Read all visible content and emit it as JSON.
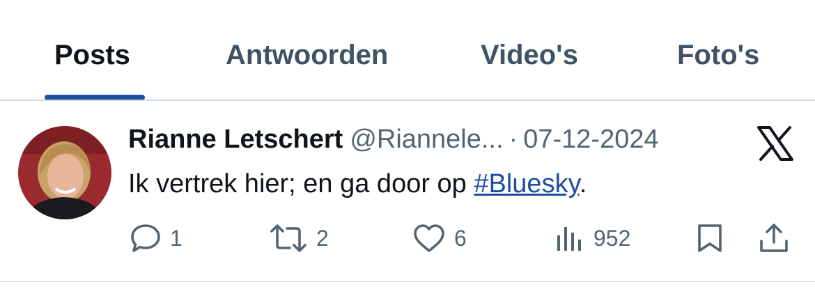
{
  "tabs": [
    {
      "label": "Posts",
      "active": true
    },
    {
      "label": "Antwoorden",
      "active": false
    },
    {
      "label": "Video's",
      "active": false
    },
    {
      "label": "Foto's",
      "active": false
    }
  ],
  "post": {
    "author_name": "Rianne Letschert",
    "author_handle": "@Riannele...",
    "separator": "·",
    "date": "07-12-2024",
    "text_before": "Ik vertrek hier; en ga door op ",
    "hashtag": "#Bluesky",
    "text_after": ".",
    "source_icon": "x-logo-icon",
    "actions": {
      "replies": "1",
      "reposts": "2",
      "likes": "6",
      "views": "952"
    }
  },
  "colors": {
    "accent": "#1d4f9e",
    "text": "#0f1419",
    "muted": "#536471",
    "divider": "#cfd9de"
  }
}
